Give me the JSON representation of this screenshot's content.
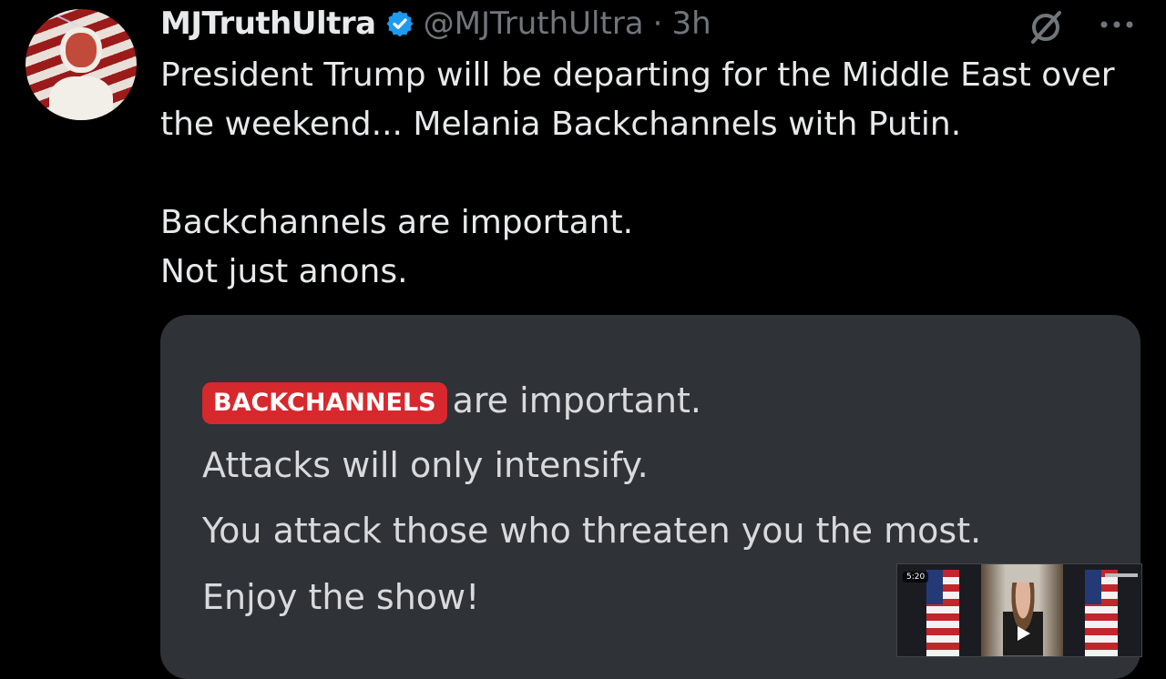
{
  "tweet": {
    "display_name": "MJTruthUltra",
    "handle": "@MJTruthUltra",
    "separator": "·",
    "time": "3h",
    "paragraphs": [
      "President Trump will be departing for the Middle East over the weekend... Melania Backchannels with Putin.",
      "Backchannels are important.",
      "Not just anons."
    ],
    "verified_color": "#1d9bf0",
    "icons": {
      "grok": "grok-icon",
      "more": "more-icon",
      "verified": "verified-badge-icon"
    }
  },
  "card": {
    "badge": "BACKCHANNELS",
    "line1_rest": "are important.",
    "line2": "Attacks will only intensify.",
    "line3": "You attack those who threaten you the most.",
    "line4": "Enjoy the show!",
    "badge_color": "#d7282d"
  },
  "video": {
    "timestamp": "5:20"
  }
}
